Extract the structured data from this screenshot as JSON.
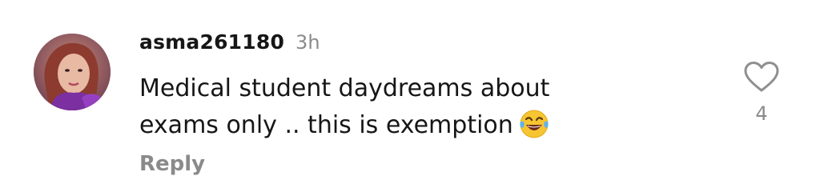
{
  "comment": {
    "username": "asma261180",
    "time": "3h",
    "text_line1": "Medical student daydreams about",
    "text_line2": "exams only .. this is exemption",
    "emoji": "face-with-tears-of-joy",
    "reply_label": "Reply",
    "like_count": "4",
    "like_icon": "heart-outline-icon",
    "colors": {
      "primary_text": "#161616",
      "secondary_text": "#8a8a8a",
      "icon_stroke": "#8f8f8f",
      "emoji_face": "#f7c531",
      "avatar_accent": "#7b2fa0"
    }
  }
}
